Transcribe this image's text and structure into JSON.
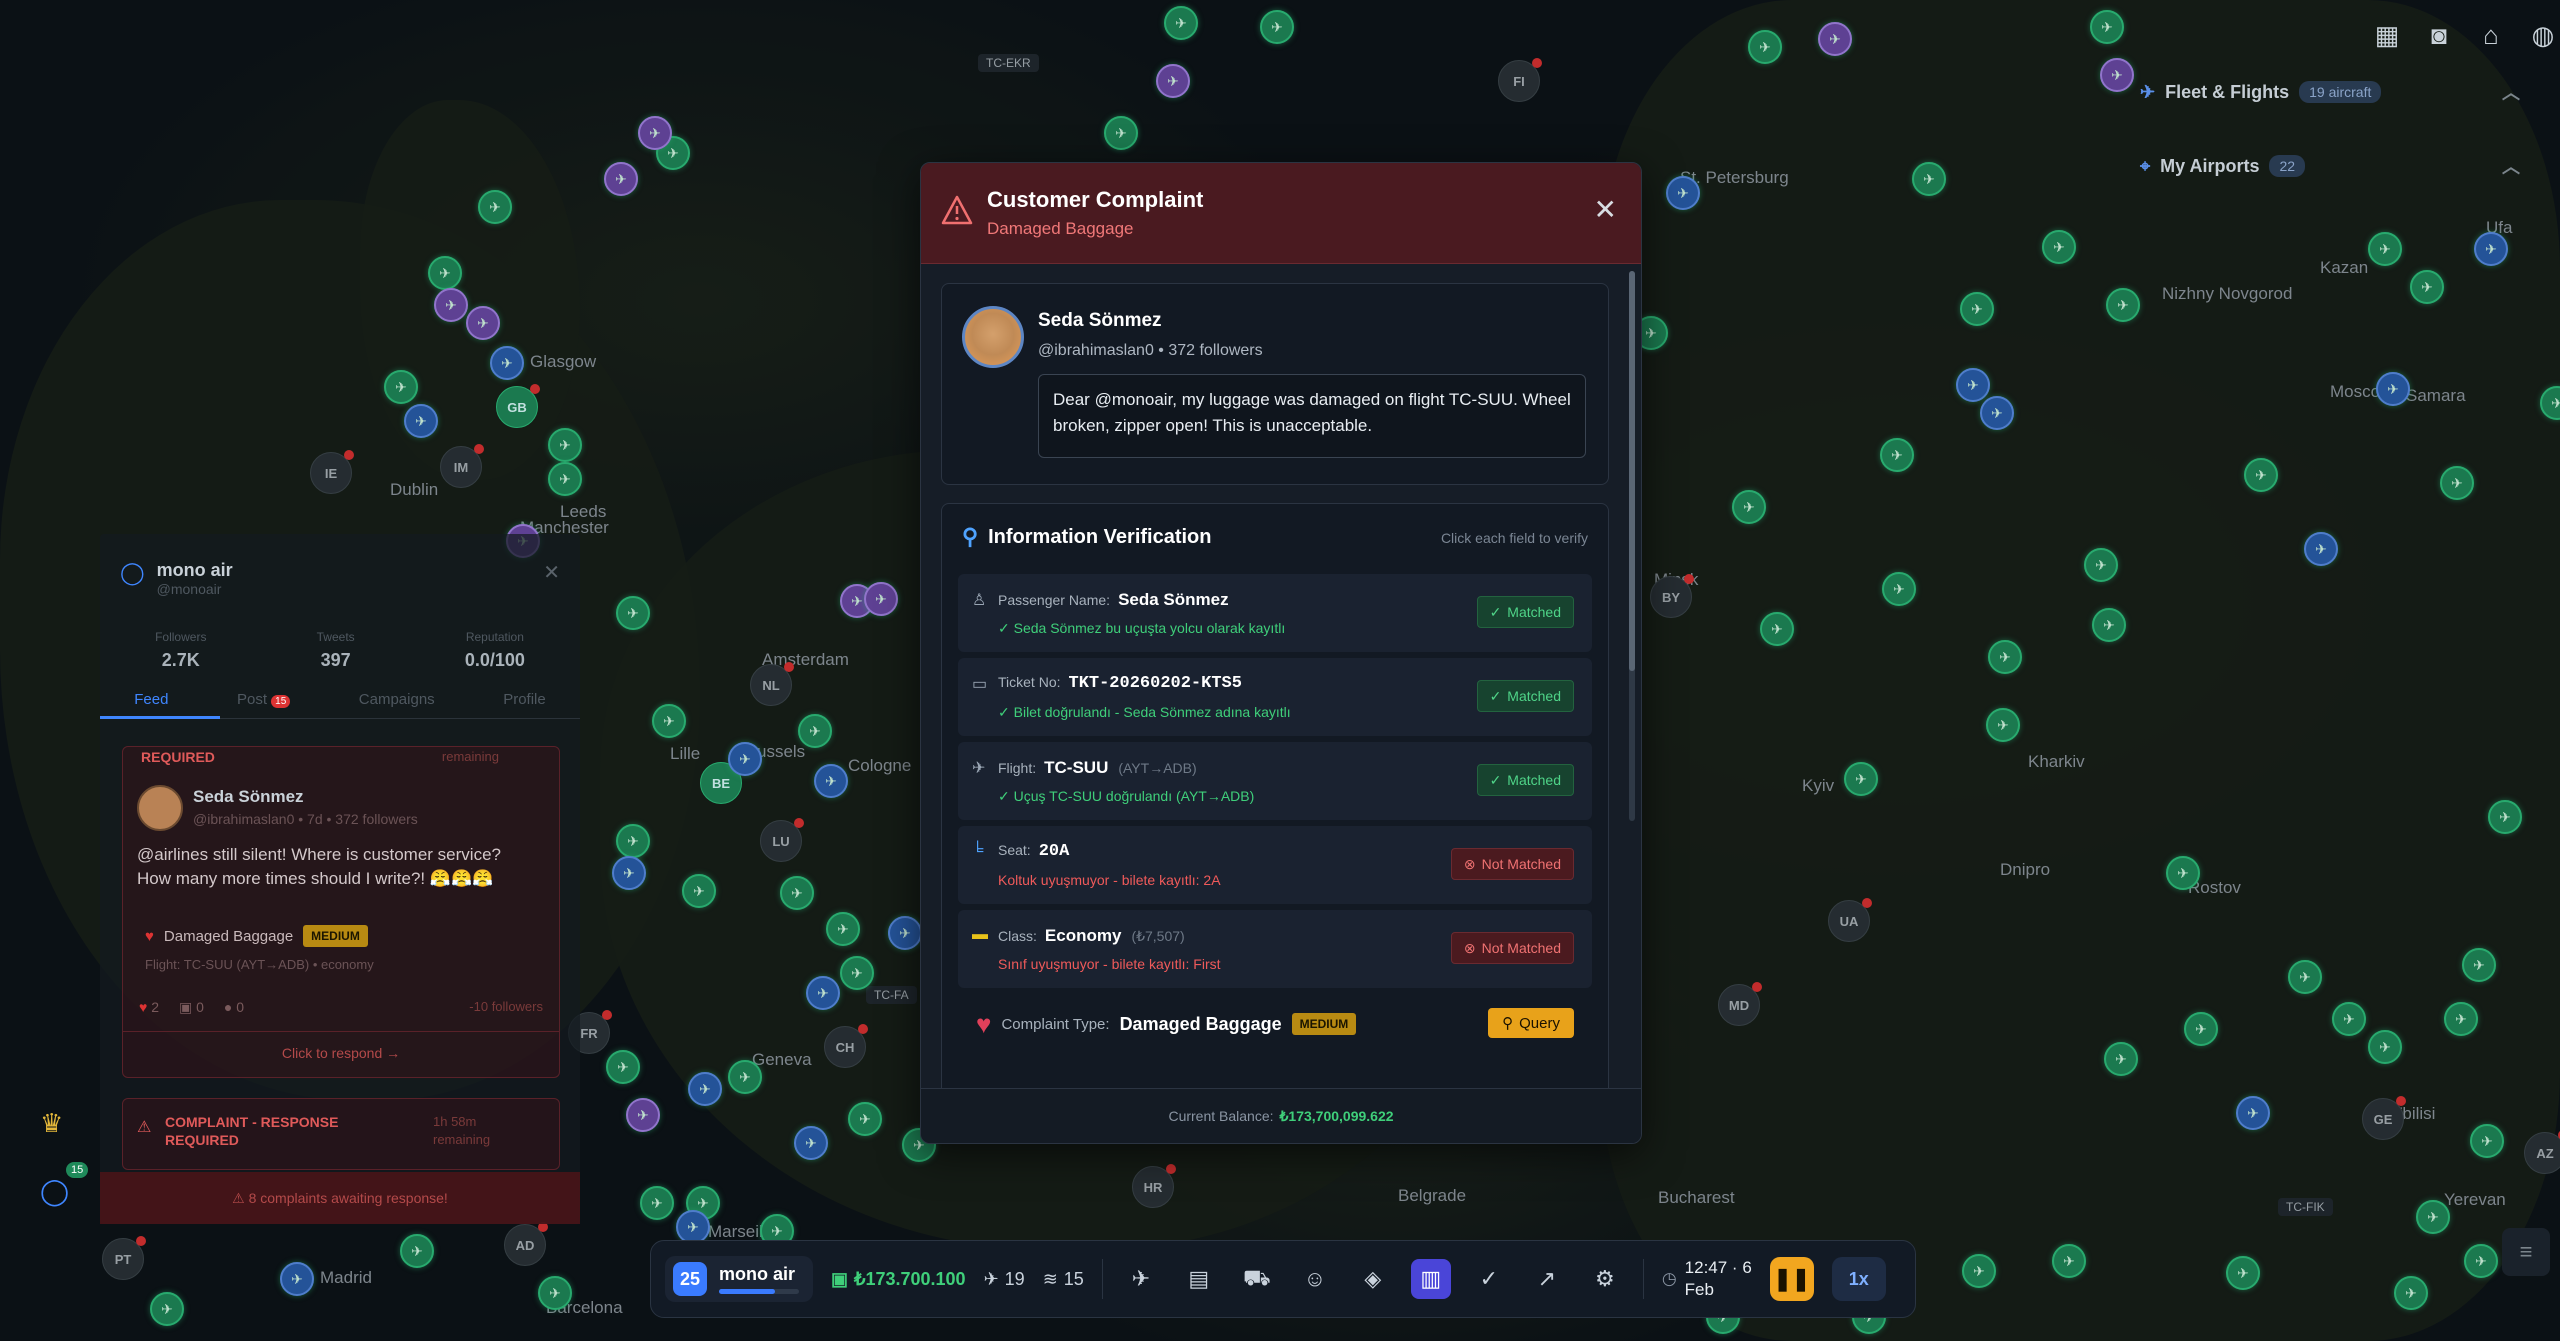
{
  "map": {
    "cities": [
      "St. Petersburg",
      "Dublin",
      "Leeds",
      "Manchester",
      "Glasgow",
      "Amsterdam",
      "Brussels",
      "Lille",
      "Cologne",
      "Geneva",
      "Barcelona",
      "Madrid",
      "Marseille",
      "Belgrade",
      "Bucharest",
      "Minsk",
      "Kyiv",
      "Kharkiv",
      "Dnipro",
      "Rostov",
      "Moscow",
      "Nizhny Novgorod",
      "Kazan",
      "Samara",
      "Ufa",
      "Tbilisi",
      "Yerevan"
    ],
    "airport_codes": [
      "FI",
      "IE",
      "IM",
      "GB",
      "NL",
      "BE",
      "LU",
      "CH",
      "PT",
      "AD",
      "HR",
      "BY",
      "UA",
      "MD",
      "GE",
      "AZ",
      "FR",
      "TC-EKR",
      "TC-FA",
      "TC-FIK"
    ]
  },
  "right_panel": {
    "fleet_label": "Fleet & Flights",
    "fleet_badge": "19 aircraft",
    "airports_label": "My Airports",
    "airports_badge": "22"
  },
  "social": {
    "name": "mono air",
    "handle": "@monoair",
    "stats": [
      {
        "label": "Followers",
        "value": "2.7K"
      },
      {
        "label": "Tweets",
        "value": "397"
      },
      {
        "label": "Reputation",
        "value": "0.0/100"
      }
    ],
    "tabs": [
      "Feed",
      "Post",
      "Campaigns",
      "Profile"
    ],
    "post_badge": "15",
    "card1": {
      "required": "REQUIRED",
      "remaining": "remaining",
      "user": "Seda Sönmez",
      "meta": "@ibrahimaslan0 • 7d • 372 followers",
      "text": "@airlines still silent! Where is customer service? How many more times should I write?! 😤😤😤",
      "complaint": "Damaged Baggage",
      "severity": "MEDIUM",
      "flight": "Flight: TC-SUU (AYT→ADB) • economy",
      "likes": "2",
      "retweets": "0",
      "comments": "0",
      "follower_loss": "-10 followers",
      "respond": "Click to respond →"
    },
    "card2": {
      "title": "COMPLAINT - RESPONSE REQUIRED",
      "time": "1h 58m",
      "remaining": "remaining"
    },
    "banner": "⚠ 8 complaints awaiting response!",
    "chat_badge": "15"
  },
  "modal": {
    "title": "Customer Complaint",
    "subtitle": "Damaged Baggage",
    "post": {
      "name": "Seda Sönmez",
      "meta": "@ibrahimaslan0 • 372 followers",
      "text": "Dear @monoair, my luggage was damaged on flight TC-SUU. Wheel broken, zipper open! This is unacceptable."
    },
    "verify": {
      "title": "Information Verification",
      "hint": "Click each field to verify",
      "rows": [
        {
          "label": "Passenger Name:",
          "value": "Seda Sönmez",
          "extra": "",
          "status": "Matched",
          "note": "✓ Seda Sönmez bu uçuşta yolcu olarak kayıtlı"
        },
        {
          "label": "Ticket No:",
          "value": "TKT-20260202-KTS5",
          "extra": "",
          "status": "Matched",
          "note": "✓ Bilet doğrulandı - Seda Sönmez adına kayıtlı"
        },
        {
          "label": "Flight:",
          "value": "TC-SUU",
          "extra": "(AYT→ADB)",
          "status": "Matched",
          "note": "✓ Uçuş TC-SUU doğrulandı (AYT→ADB)"
        },
        {
          "label": "Seat:",
          "value": "20A",
          "extra": "",
          "status": "Not Matched",
          "note": "Koltuk uyuşmuyor - bilete kayıtlı: 2A"
        },
        {
          "label": "Class:",
          "value": "Economy",
          "extra": "(₺7,507)",
          "status": "Not Matched",
          "note": "Sınıf uyuşmuyor - bilete kayıtlı: First"
        }
      ],
      "complaint_type_label": "Complaint Type:",
      "complaint_type": "Damaged Baggage",
      "severity": "MEDIUM",
      "query": "Query"
    },
    "balance_label": "Current Balance:",
    "balance": "₺173,700,099.622"
  },
  "bar": {
    "level": "25",
    "brand": "mono air",
    "xp_fraction": 0.7,
    "money": "₺173.700.100",
    "planes": "19",
    "routes": "15",
    "time": "12:47 · 6",
    "date": "Feb",
    "speed": "1x"
  }
}
